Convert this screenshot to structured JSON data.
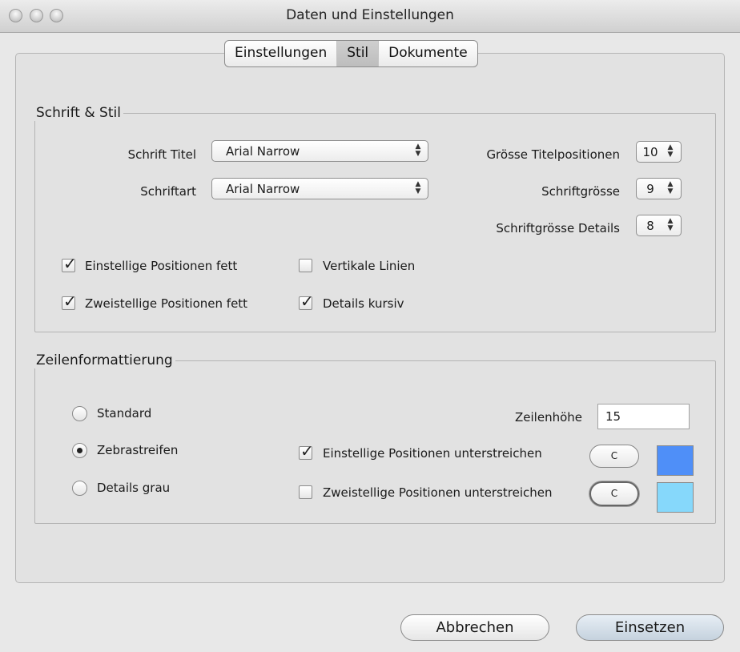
{
  "window": {
    "title": "Daten und Einstellungen"
  },
  "tabs": [
    {
      "label": "Einstellungen",
      "selected": false
    },
    {
      "label": "Stil",
      "selected": true
    },
    {
      "label": "Dokumente",
      "selected": false
    }
  ],
  "font_section": {
    "legend": "Schrift & Stil",
    "title_font": {
      "label": "Schrift Titel",
      "value": "Arial Narrow"
    },
    "font_type": {
      "label": "Schriftart",
      "value": "Arial Narrow"
    },
    "title_position_size": {
      "label": "Grösse Titelpositionen",
      "value": "10"
    },
    "font_size": {
      "label": "Schriftgrösse",
      "value": "9"
    },
    "detail_font_size": {
      "label": "Schriftgrösse Details",
      "value": "8"
    },
    "checkboxes": {
      "single_digit_bold": {
        "label": "Einstellige Positionen fett",
        "checked": true
      },
      "vertical_lines": {
        "label": "Vertikale Linien",
        "checked": false
      },
      "two_digit_bold": {
        "label": "Zweistellige Positionen fett",
        "checked": true
      },
      "details_italic": {
        "label": "Details kursiv",
        "checked": true
      }
    }
  },
  "row_section": {
    "legend": "Zeilenformattierung",
    "radios": {
      "standard": {
        "label": "Standard",
        "selected": false
      },
      "zebra": {
        "label": "Zebrastreifen",
        "selected": true
      },
      "details_grey": {
        "label": "Details grau",
        "selected": false
      }
    },
    "row_height": {
      "label": "Zeilenhöhe",
      "value": "15"
    },
    "underline_single": {
      "label": "Einstellige Positionen unterstreichen",
      "checked": true,
      "button_label": "C",
      "color": "#4f8ff8"
    },
    "underline_two": {
      "label": "Zweistellige Positionen unterstreichen",
      "checked": false,
      "button_label": "C",
      "color": "#86d8fb"
    }
  },
  "footer": {
    "cancel_label": "Abbrechen",
    "apply_label": "Einsetzen"
  }
}
